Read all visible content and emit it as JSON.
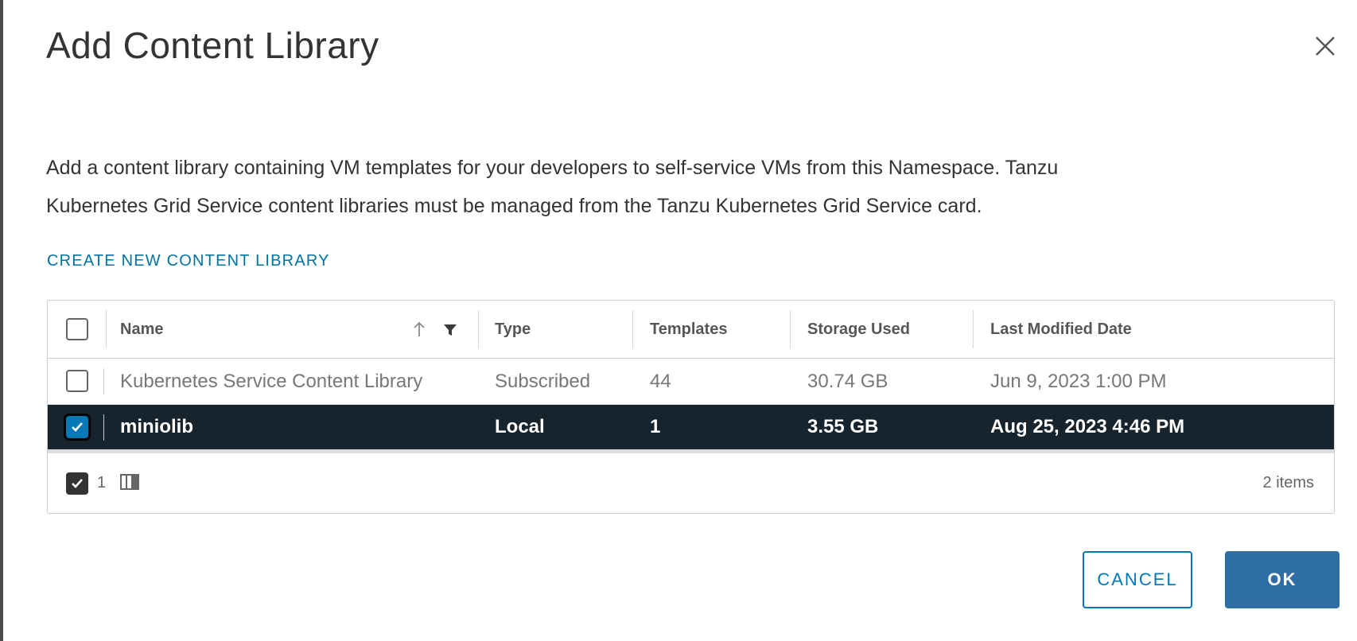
{
  "dialog": {
    "title": "Add Content Library",
    "description_line1": "Add a content library containing VM templates for your developers to self-service VMs from this Namespace. Tanzu",
    "description_line2": "Kubernetes Grid Service content libraries must be managed from the Tanzu Kubernetes Grid Service card.",
    "create_link": "CREATE NEW CONTENT LIBRARY"
  },
  "grid": {
    "columns": [
      "Name",
      "Type",
      "Templates",
      "Storage Used",
      "Last Modified Date"
    ],
    "rows": [
      {
        "selected": false,
        "name": "Kubernetes Service Content Library",
        "type": "Subscribed",
        "templates": "44",
        "storage": "30.74 GB",
        "modified": "Jun 9, 2023 1:00 PM"
      },
      {
        "selected": true,
        "name": "miniolib",
        "type": "Local",
        "templates": "1",
        "storage": "3.55 GB",
        "modified": "Aug 25, 2023 4:46 PM"
      }
    ],
    "footer": {
      "selected_count": "1",
      "items_count": "2 items"
    }
  },
  "actions": {
    "cancel_label": "CANCEL",
    "ok_label": "OK"
  },
  "colors": {
    "accent": "#0079b8",
    "selected_row": "#17242d",
    "ok_button": "#2f6ea5",
    "link": "#0072a3"
  },
  "icons": [
    "close-icon",
    "sort-ascending-icon",
    "filter-icon",
    "checkmark-icon",
    "column-toggle-icon"
  ]
}
